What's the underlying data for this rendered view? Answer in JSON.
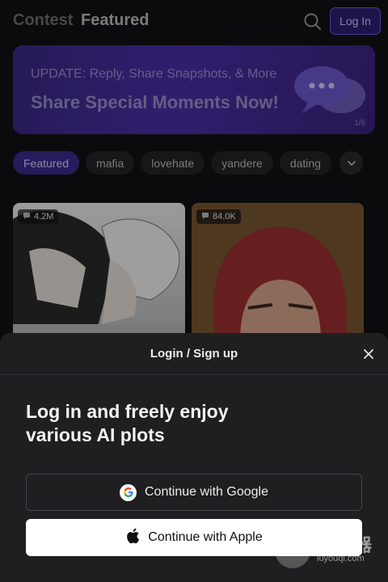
{
  "header": {
    "tab_contest": "Contest",
    "tab_featured": "Featured",
    "login_label": "Log In"
  },
  "banner": {
    "top_text": "UPDATE: Reply, Share Snapshots, & More",
    "main_text": "Share Special Moments Now!",
    "page_indicator": "1/6"
  },
  "chips": [
    "Featured",
    "mafia",
    "lovehate",
    "yandere",
    "dating"
  ],
  "cards": [
    {
      "count": "4.2M"
    },
    {
      "count": "84.0K"
    }
  ],
  "sheet": {
    "title": "Login / Sign up",
    "heading_line1": "Log in and freely enjoy",
    "heading_line2": "various AI plots",
    "google_label": "Continue with Google",
    "apple_label": "Continue with Apple"
  },
  "watermark": {
    "name": "路由器",
    "url": "luyouqi.com"
  },
  "colors": {
    "accent": "#3b2a8e",
    "accent_border": "#6b55e6",
    "sheet_bg": "#1f1f21"
  }
}
